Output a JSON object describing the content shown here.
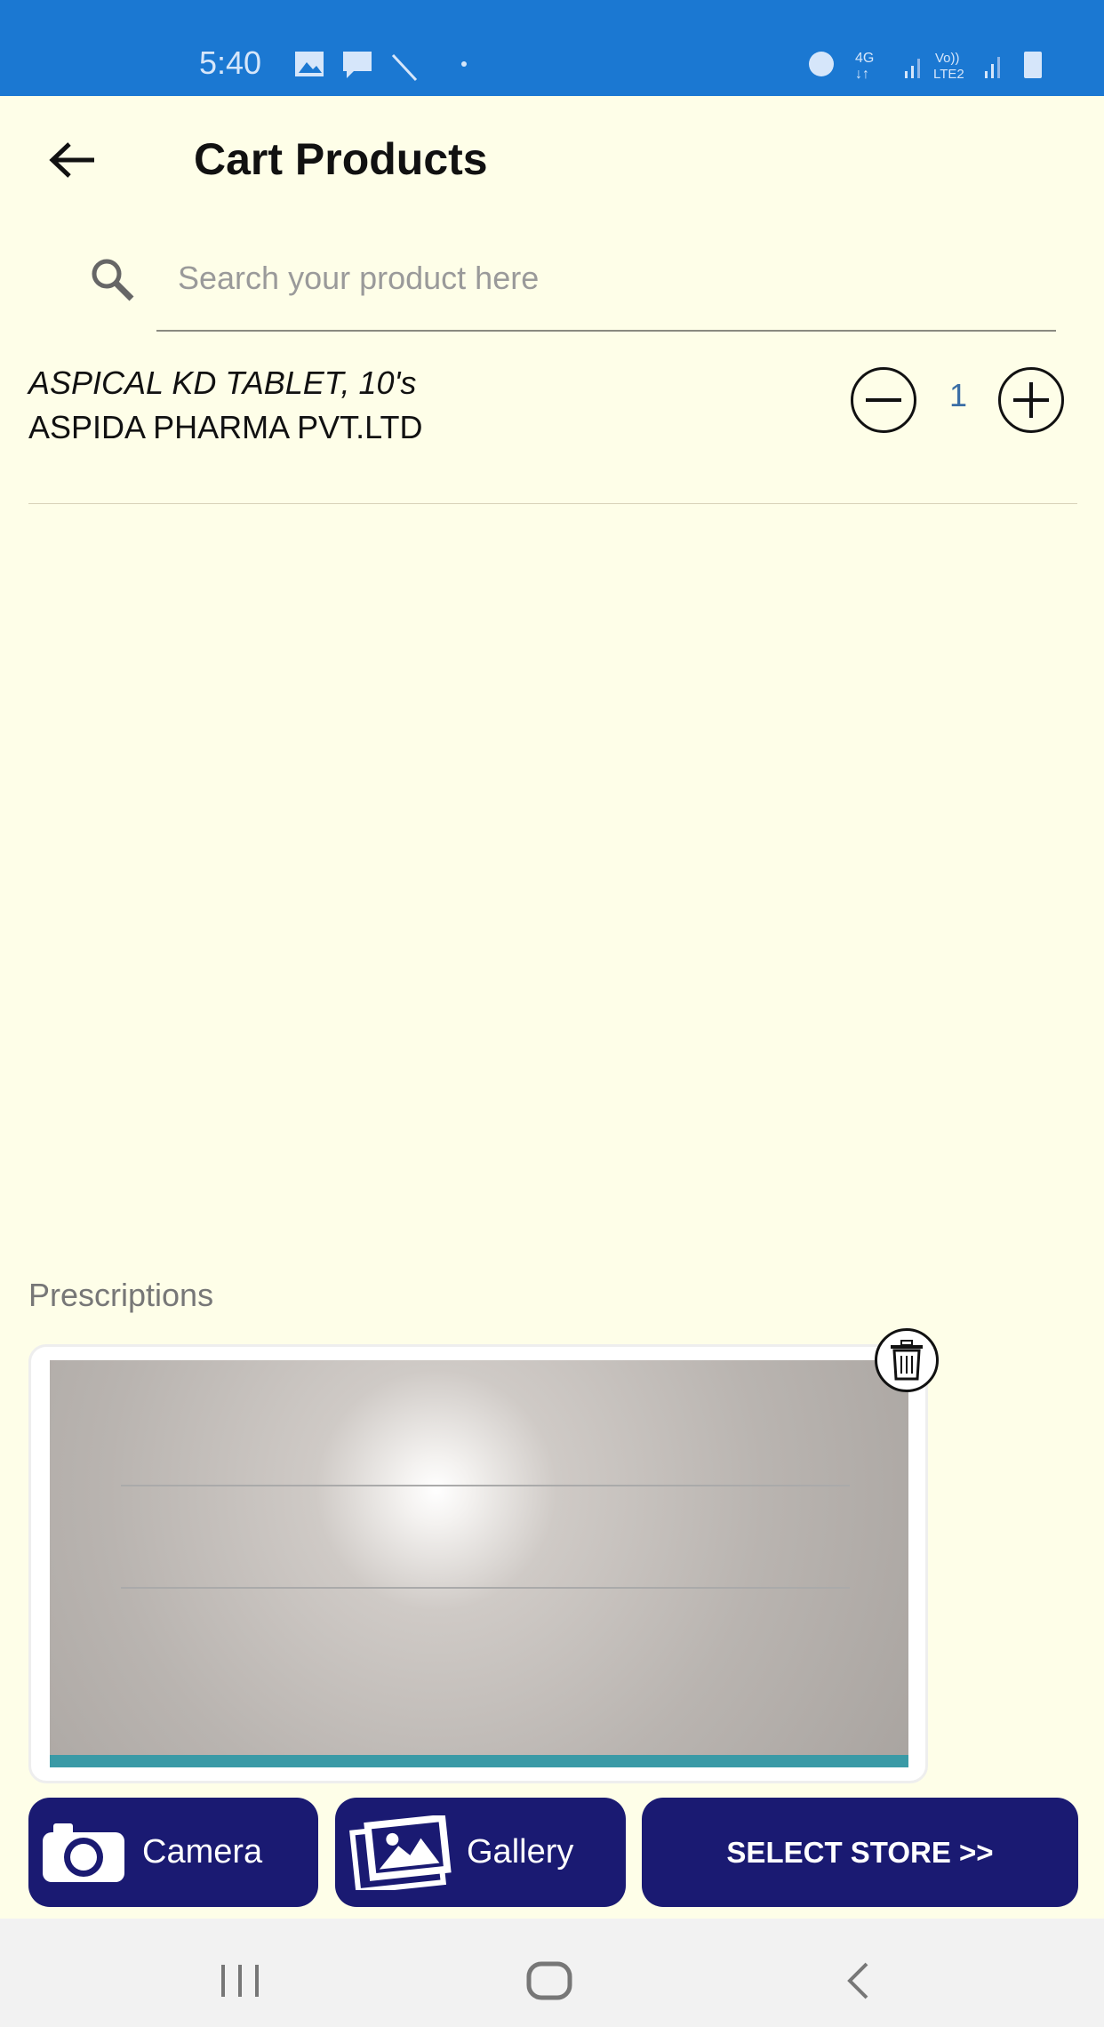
{
  "status_bar": {
    "time": "5:40",
    "network": "4G",
    "sim2_line1": "Vo))",
    "sim2_line2": "LTE2",
    "icons": [
      "image-icon",
      "message-icon",
      "magic-wand-icon",
      "alarm-icon",
      "signal-icon",
      "battery-icon"
    ]
  },
  "header": {
    "title": "Cart Products",
    "back_icon": "arrow-left-icon"
  },
  "search": {
    "placeholder": "Search your product here"
  },
  "cart": {
    "items": [
      {
        "name": "ASPICAL KD TABLET, 10's",
        "manufacturer": "ASPIDA PHARMA PVT.LTD",
        "quantity": "1"
      }
    ]
  },
  "prescriptions": {
    "label": "Prescriptions"
  },
  "buttons": {
    "camera": "Camera",
    "gallery": "Gallery",
    "select_store": "SELECT STORE >>"
  },
  "colors": {
    "status_bar": "#1b78d2",
    "background": "#fefee8",
    "button": "#1a1a72"
  }
}
